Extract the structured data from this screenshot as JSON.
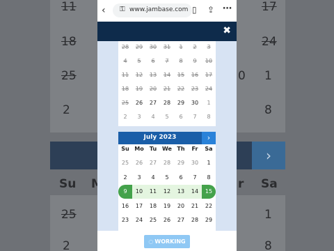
{
  "browser": {
    "url": "www.jambase.com",
    "back_icon": "‹",
    "lock_icon": "⚿",
    "bookmark_icon": "▯",
    "share_icon": "⇪",
    "more_icon": "⋯"
  },
  "modal": {
    "close_icon": "✖"
  },
  "background": {
    "numbers": [
      "11",
      "17",
      "18",
      "24",
      "25",
      "0",
      "1",
      "2",
      "8",
      "25",
      "1",
      "2",
      "8"
    ],
    "days": [
      "Su",
      "M",
      "r",
      "Sa"
    ],
    "arrow": "›"
  },
  "calendar1": {
    "rows": [
      [
        "28",
        "29",
        "30",
        "31",
        "1",
        "2",
        "3"
      ],
      [
        "4",
        "5",
        "6",
        "7",
        "8",
        "9",
        "10"
      ],
      [
        "11",
        "12",
        "13",
        "14",
        "15",
        "16",
        "17"
      ],
      [
        "18",
        "19",
        "20",
        "21",
        "22",
        "23",
        "24"
      ],
      [
        "25",
        "26",
        "27",
        "28",
        "29",
        "30",
        "1"
      ],
      [
        "2",
        "3",
        "4",
        "5",
        "6",
        "7",
        "8"
      ]
    ]
  },
  "calendar2": {
    "title": "July 2023",
    "next_icon": "›",
    "weekdays": [
      "Su",
      "Mo",
      "Tu",
      "We",
      "Th",
      "Fr",
      "Sa"
    ],
    "rows": [
      [
        "25",
        "26",
        "27",
        "28",
        "29",
        "30",
        "1"
      ],
      [
        "2",
        "3",
        "4",
        "5",
        "6",
        "7",
        "8"
      ],
      [
        "9",
        "10",
        "11",
        "12",
        "13",
        "14",
        "15"
      ],
      [
        "16",
        "17",
        "18",
        "19",
        "20",
        "21",
        "22"
      ],
      [
        "23",
        "24",
        "25",
        "26",
        "27",
        "28",
        "29"
      ]
    ],
    "selected_start": "9",
    "selected_end": "15"
  },
  "footer": {
    "working_label": "WORKING",
    "spinner_icon": "◌"
  },
  "colors": {
    "header_navy": "#0e2b4b",
    "calendar_header": "#1a5ea8",
    "selected_green": "#44a24b",
    "range_green": "#e4f5e0",
    "working_blue": "#8fc8f4"
  }
}
